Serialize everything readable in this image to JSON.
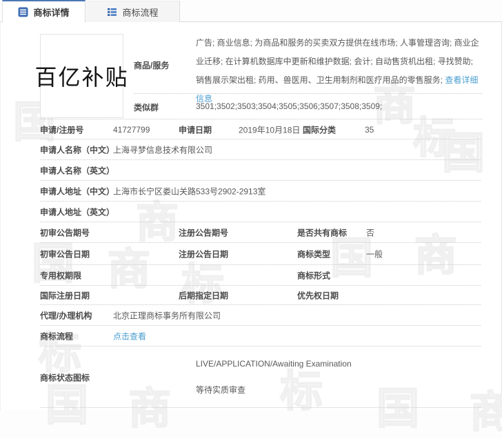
{
  "colors": {
    "accent_blue": "#4a77b4",
    "link_blue": "#4a9ecf",
    "tab_icon_blue": "#3f6db5"
  },
  "tabs": {
    "details": "商标详情",
    "process": "商标流程"
  },
  "mark": {
    "logo_text": "百亿补贴"
  },
  "goods": {
    "label": "商品/服务",
    "text": "广告; 商业信息; 为商品和服务的买卖双方提供在线市场; 人事管理咨询; 商业企业迁移; 在计算机数据库中更新和维护数据; 会计; 自动售货机出租; 寻找赞助; 销售展示架出租; 药用、兽医用、卫生用制剂和医疗用品的零售服务; ",
    "detail_link": "查看详细信息"
  },
  "similar_group": {
    "label": "类似群",
    "value": "3501;3502;3503;3504;3505;3506;3507;3508;3509;"
  },
  "fields": {
    "reg_number": {
      "label": "申请/注册号",
      "value": "41727799"
    },
    "apply_date": {
      "label": "申请日期",
      "value": "2019年10月18日"
    },
    "intl_class": {
      "label": "国际分类",
      "value": "35"
    },
    "applicant_cn": {
      "label": "申请人名称（中文）",
      "value": "上海寻梦信息技术有限公司"
    },
    "applicant_en": {
      "label": "申请人名称（英文）",
      "value": ""
    },
    "address_cn": {
      "label": "申请人地址（中文）",
      "value": "上海市长宁区娄山关路533号2902-2913室"
    },
    "address_en": {
      "label": "申请人地址（英文）",
      "value": ""
    },
    "first_notice_no": {
      "label": "初审公告期号",
      "value": ""
    },
    "reg_notice_no": {
      "label": "注册公告期号",
      "value": ""
    },
    "shared_mark": {
      "label": "是否共有商标",
      "value": "否"
    },
    "first_notice_date": {
      "label": "初审公告日期",
      "value": ""
    },
    "reg_notice_date": {
      "label": "注册公告日期",
      "value": ""
    },
    "mark_type": {
      "label": "商标类型",
      "value": "一般"
    },
    "exclusive_period": {
      "label": "专用权期限",
      "value": ""
    },
    "mark_form": {
      "label": "商标形式",
      "value": ""
    },
    "intl_reg_date": {
      "label": "国际注册日期",
      "value": ""
    },
    "later_designation_date": {
      "label": "后期指定日期",
      "value": ""
    },
    "priority_date": {
      "label": "优先权日期",
      "value": ""
    },
    "agency": {
      "label": "代理/办理机构",
      "value": "北京正理商标事务所有限公司"
    }
  },
  "process_row": {
    "label": "商标流程",
    "link": "点击查看"
  },
  "status": {
    "label": "商标状态图标",
    "line1": "LIVE/APPLICATION/Awaiting Examination",
    "line2": "等待实质审查"
  },
  "watermark": {
    "chars": [
      "国",
      "商",
      "标"
    ]
  }
}
